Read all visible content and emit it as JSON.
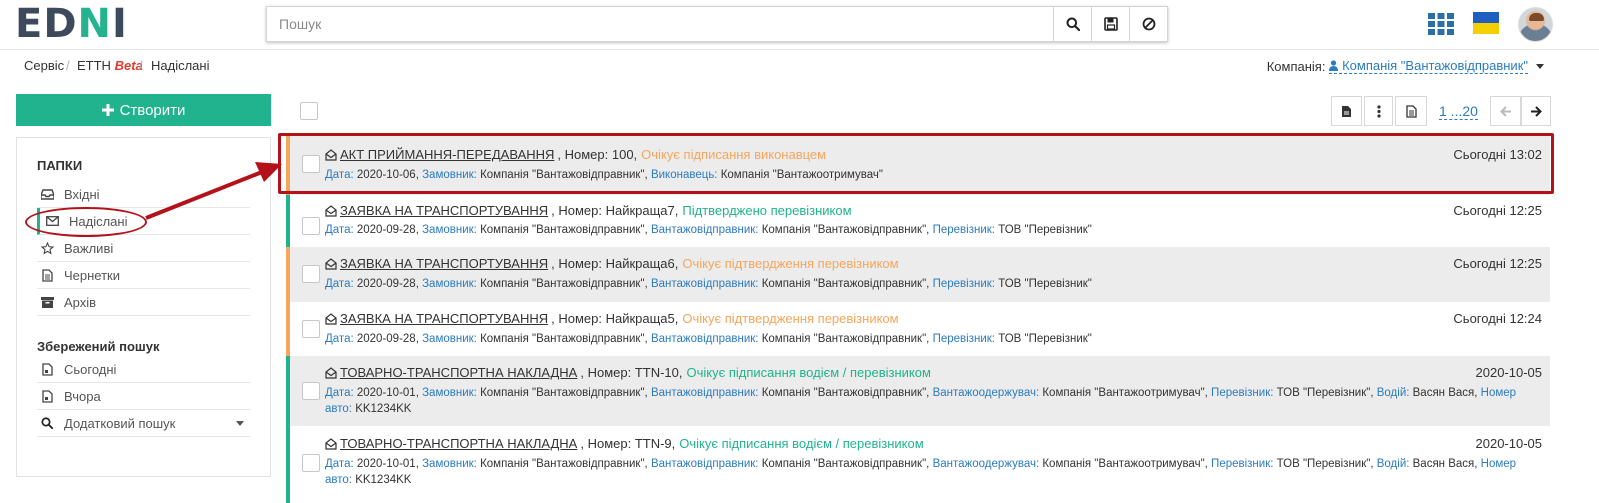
{
  "header": {
    "logo_part1": "ED",
    "logo_part2": "N",
    "logo_part3": "I",
    "search": {
      "placeholder": "Пошук",
      "value": ""
    },
    "icons": [
      "search-icon",
      "save-icon",
      "cancel-icon",
      "apps-grid-icon",
      "ukraine-flag-icon",
      "avatar"
    ]
  },
  "breadcrumb": {
    "items": [
      "Сервіс",
      "ЕТТН",
      "Надіслані"
    ],
    "beta_label": "Beta"
  },
  "company": {
    "label": "Компанія:",
    "value": "Компанія \"Вантажовідправник\""
  },
  "sidebar": {
    "create_label": "Створити",
    "folders_title": "ПАПКИ",
    "folders": [
      {
        "label": "Вхідні",
        "icon": "inbox-icon"
      },
      {
        "label": "Надіслані",
        "icon": "envelope-icon"
      },
      {
        "label": "Важливі",
        "icon": "star-icon"
      },
      {
        "label": "Чернетки",
        "icon": "draft-icon"
      },
      {
        "label": "Архів",
        "icon": "archive-icon"
      }
    ],
    "saved_title": "Збережений пошук",
    "saved": [
      {
        "label": "Сьогодні",
        "icon": "calendar-icon"
      },
      {
        "label": "Вчора",
        "icon": "calendar-icon"
      },
      {
        "label": "Додатковий пошук",
        "icon": "search-icon"
      }
    ]
  },
  "pager": {
    "range": "1 ...20"
  },
  "documents": [
    {
      "title": "АКТ ПРИЙМАННЯ-ПЕРЕДАВАННЯ",
      "number": ", Номер: 100,",
      "status": "Очікує підписання виконавцем",
      "status_color": "#f5a65b",
      "time": "Сьогодні 13:02",
      "details": [
        {
          "label": "Дата:",
          "value": "2020-10-06,"
        },
        {
          "label": "Замовник:",
          "value": "Компанія \"Вантажовідправник\","
        },
        {
          "label": "Виконавець:",
          "value": "Компанія \"Вантажоотримувач\""
        }
      ]
    },
    {
      "title": "ЗАЯВКА НА ТРАНСПОРТУВАННЯ",
      "number": ", Номер: Найкраща7,",
      "status": "Підтверджено перевізником",
      "status_color": "#20b38d",
      "time": "Сьогодні 12:25",
      "details": [
        {
          "label": "Дата:",
          "value": "2020-09-28,"
        },
        {
          "label": "Замовник:",
          "value": "Компанія \"Вантажовідправник\","
        },
        {
          "label": "Вантажовідправник:",
          "value": "Компанія \"Вантажовідправник\","
        },
        {
          "label": "Перевізник:",
          "value": "ТОВ \"Перевізник\""
        }
      ]
    },
    {
      "title": "ЗАЯВКА НА ТРАНСПОРТУВАННЯ",
      "number": ", Номер: Найкраща6,",
      "status": "Очікує підтвердження перевізником",
      "status_color": "#f5a65b",
      "time": "Сьогодні 12:25",
      "details": [
        {
          "label": "Дата:",
          "value": "2020-09-28,"
        },
        {
          "label": "Замовник:",
          "value": "Компанія \"Вантажовідправник\","
        },
        {
          "label": "Вантажовідправник:",
          "value": "Компанія \"Вантажовідправник\","
        },
        {
          "label": "Перевізник:",
          "value": "ТОВ \"Перевізник\""
        }
      ]
    },
    {
      "title": "ЗАЯВКА НА ТРАНСПОРТУВАННЯ",
      "number": ", Номер: Найкраща5,",
      "status": "Очікує підтвердження перевізником",
      "status_color": "#f5a65b",
      "time": "Сьогодні 12:24",
      "details": [
        {
          "label": "Дата:",
          "value": "2020-09-28,"
        },
        {
          "label": "Замовник:",
          "value": "Компанія \"Вантажовідправник\","
        },
        {
          "label": "Вантажовідправник:",
          "value": "Компанія \"Вантажовідправник\","
        },
        {
          "label": "Перевізник:",
          "value": "ТОВ \"Перевізник\""
        }
      ]
    },
    {
      "title": "ТОВАРНО-ТРАНСПОРТНА НАКЛАДНА",
      "number": ", Номер: TTN-10,",
      "status": "Очікує підписання водієм / перевізником",
      "status_color": "#20b38d",
      "time": "2020-10-05",
      "details": [
        {
          "label": "Дата:",
          "value": "2020-10-01,"
        },
        {
          "label": "Замовник:",
          "value": "Компанія \"Вантажовідправник\","
        },
        {
          "label": "Вантажовідправник:",
          "value": "Компанія \"Вантажовідправник\","
        },
        {
          "label": "Вантажоодержувач:",
          "value": "Компанія \"Вантажоотримувач\","
        },
        {
          "label": "Перевізник:",
          "value": "ТОВ \"Перевізник\","
        },
        {
          "label": "Водій:",
          "value": "Васян Вася,"
        },
        {
          "label": "Номер авто:",
          "value": "KK1234KK"
        }
      ]
    },
    {
      "title": "ТОВАРНО-ТРАНСПОРТНА НАКЛАДНА",
      "number": ", Номер: TTN-9,",
      "status": "Очікує підписання водієм / перевізником",
      "status_color": "#20b38d",
      "time": "2020-10-05",
      "details": [
        {
          "label": "Дата:",
          "value": "2020-10-01,"
        },
        {
          "label": "Замовник:",
          "value": "Компанія \"Вантажовідправник\","
        },
        {
          "label": "Вантажовідправник:",
          "value": "Компанія \"Вантажовідправник\","
        },
        {
          "label": "Вантажоодержувач:",
          "value": "Компанія \"Вантажоотримувач\","
        },
        {
          "label": "Перевізник:",
          "value": "ТОВ \"Перевізник\","
        },
        {
          "label": "Водій:",
          "value": "Васян Вася,"
        },
        {
          "label": "Номер авто:",
          "value": "KK1234KK"
        }
      ]
    }
  ]
}
